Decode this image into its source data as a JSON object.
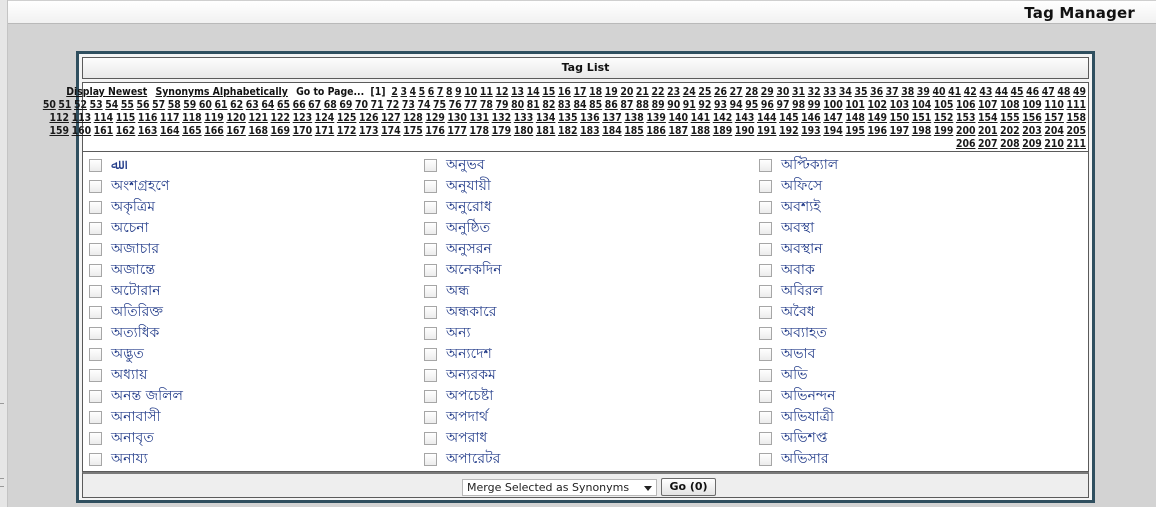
{
  "header": {
    "title": "Tag Manager"
  },
  "panel": {
    "title": "Tag List"
  },
  "pager": {
    "display_newest": "Display Newest",
    "synonyms_alpha": "Synonyms Alphabetically",
    "goto_label": "Go to Page...",
    "current_page": "[1]",
    "total_pages": 211
  },
  "tags": {
    "col1": [
      "ﷲ",
      "অংশগ্রহণে",
      "অকৃত্রিম",
      "অচেনা",
      "অজাচার",
      "অজান্তে",
      "অটোরান",
      "অতিরিক্ত",
      "অত্যধিক",
      "অদ্ভুত",
      "অধ্যায়",
      "অনন্ত জলিল",
      "অনাবাসী",
      "অনাবৃত",
      "অনায্য"
    ],
    "col2": [
      "অনুভব",
      "অনুযায়ী",
      "অনুরোধ",
      "অনুষ্ঠিত",
      "অনুসরন",
      "অনেকদিন",
      "অন্ধ",
      "অন্ধকারে",
      "অন্য",
      "অন্যদেশ",
      "অন্যরকম",
      "অপচেষ্টা",
      "অপদার্থ",
      "অপরাধ",
      "অপারেটর"
    ],
    "col3": [
      "অপ্টিক্যাল",
      "অফিসে",
      "অবশ্যই",
      "অবস্থা",
      "অবস্থান",
      "অবাক",
      "অবিরল",
      "অবৈধ",
      "অব্যাহত",
      "অভাব",
      "অভি",
      "অভিনন্দন",
      "অভিযাত্রী",
      "অভিশপ্ত",
      "অভিসার"
    ]
  },
  "footer": {
    "merge_select_value": "Merge Selected as Synonyms",
    "go_button": "Go (0)"
  }
}
